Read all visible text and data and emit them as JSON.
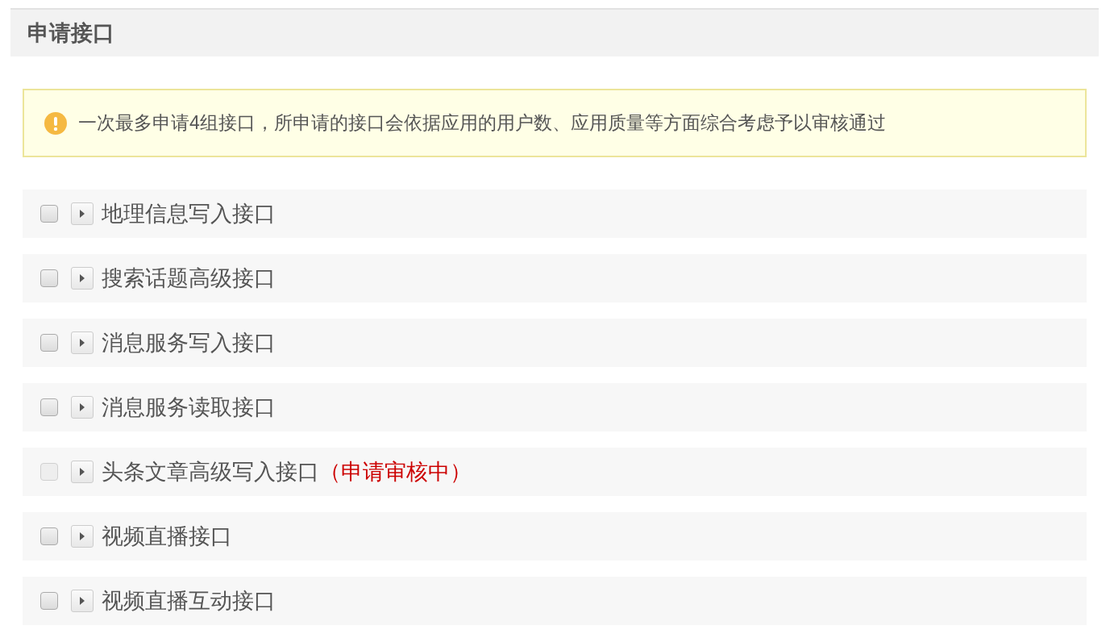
{
  "header": {
    "title": "申请接口"
  },
  "notice": {
    "text": "一次最多申请4组接口，所申请的接口会依据应用的用户数、应用质量等方面综合考虑予以审核通过"
  },
  "interfaces": [
    {
      "name": "地理信息写入接口",
      "checked": false,
      "disabled": false,
      "expanded": false
    },
    {
      "name": "搜索话题高级接口",
      "checked": false,
      "disabled": false,
      "expanded": false
    },
    {
      "name": "消息服务写入接口",
      "checked": false,
      "disabled": false,
      "expanded": false
    },
    {
      "name": "消息服务读取接口",
      "checked": false,
      "disabled": false,
      "expanded": false
    },
    {
      "name": "头条文章高级写入接口",
      "checked": false,
      "disabled": true,
      "expanded": false,
      "status": "（申请审核中）"
    },
    {
      "name": "视频直播接口",
      "checked": false,
      "disabled": false,
      "expanded": false
    },
    {
      "name": "视频直播互动接口",
      "checked": false,
      "disabled": false,
      "expanded": false
    }
  ]
}
